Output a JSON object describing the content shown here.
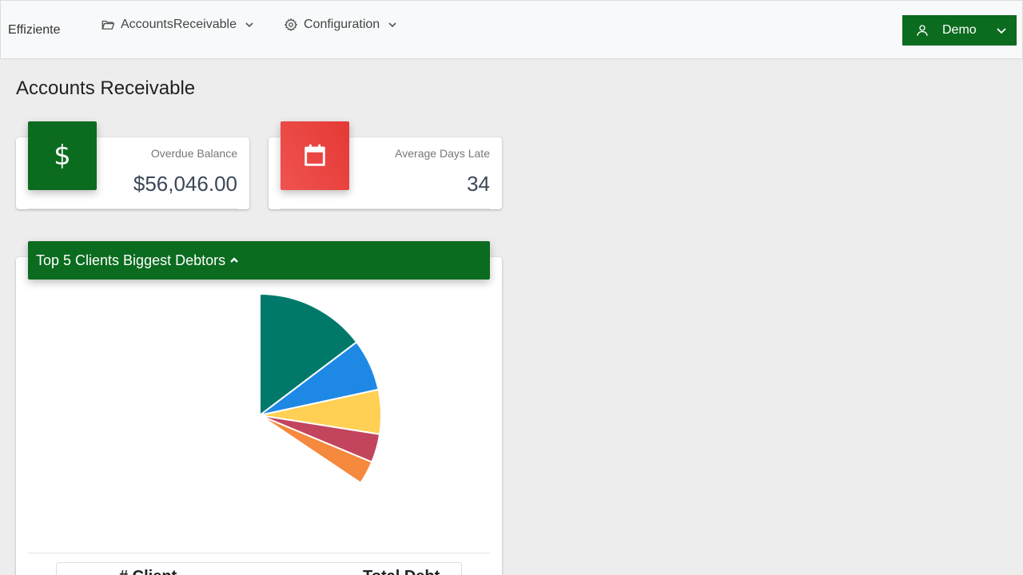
{
  "navbar": {
    "brand": "Effiziente",
    "menus": [
      {
        "label": "AccountsReceivable",
        "icon": "folder-open-icon"
      },
      {
        "label": "Configuration",
        "icon": "gear-icon"
      }
    ],
    "user": {
      "label": "Demo",
      "icon": "user-icon"
    }
  },
  "page": {
    "title": "Accounts Receivable"
  },
  "stats": {
    "overdue": {
      "label": "Overdue Balance",
      "value": "$56,046.00",
      "icon_char": "$",
      "color": "#0b6b1f"
    },
    "days": {
      "label": "Average Days Late",
      "value": "34",
      "icon": "calendar-icon",
      "color": "#e53935"
    }
  },
  "chart": {
    "header": "Top 5 Clients Biggest Debtors"
  },
  "chart_data": {
    "type": "pie",
    "values": [
      14.7,
      6.9,
      5.9,
      3.8,
      3.1
    ],
    "colors": [
      "#00796b",
      "#1e88e5",
      "#ffd054",
      "#c2455d",
      "#f5893d"
    ]
  },
  "table": {
    "headers": [
      "# Client",
      "Total Debt"
    ]
  }
}
